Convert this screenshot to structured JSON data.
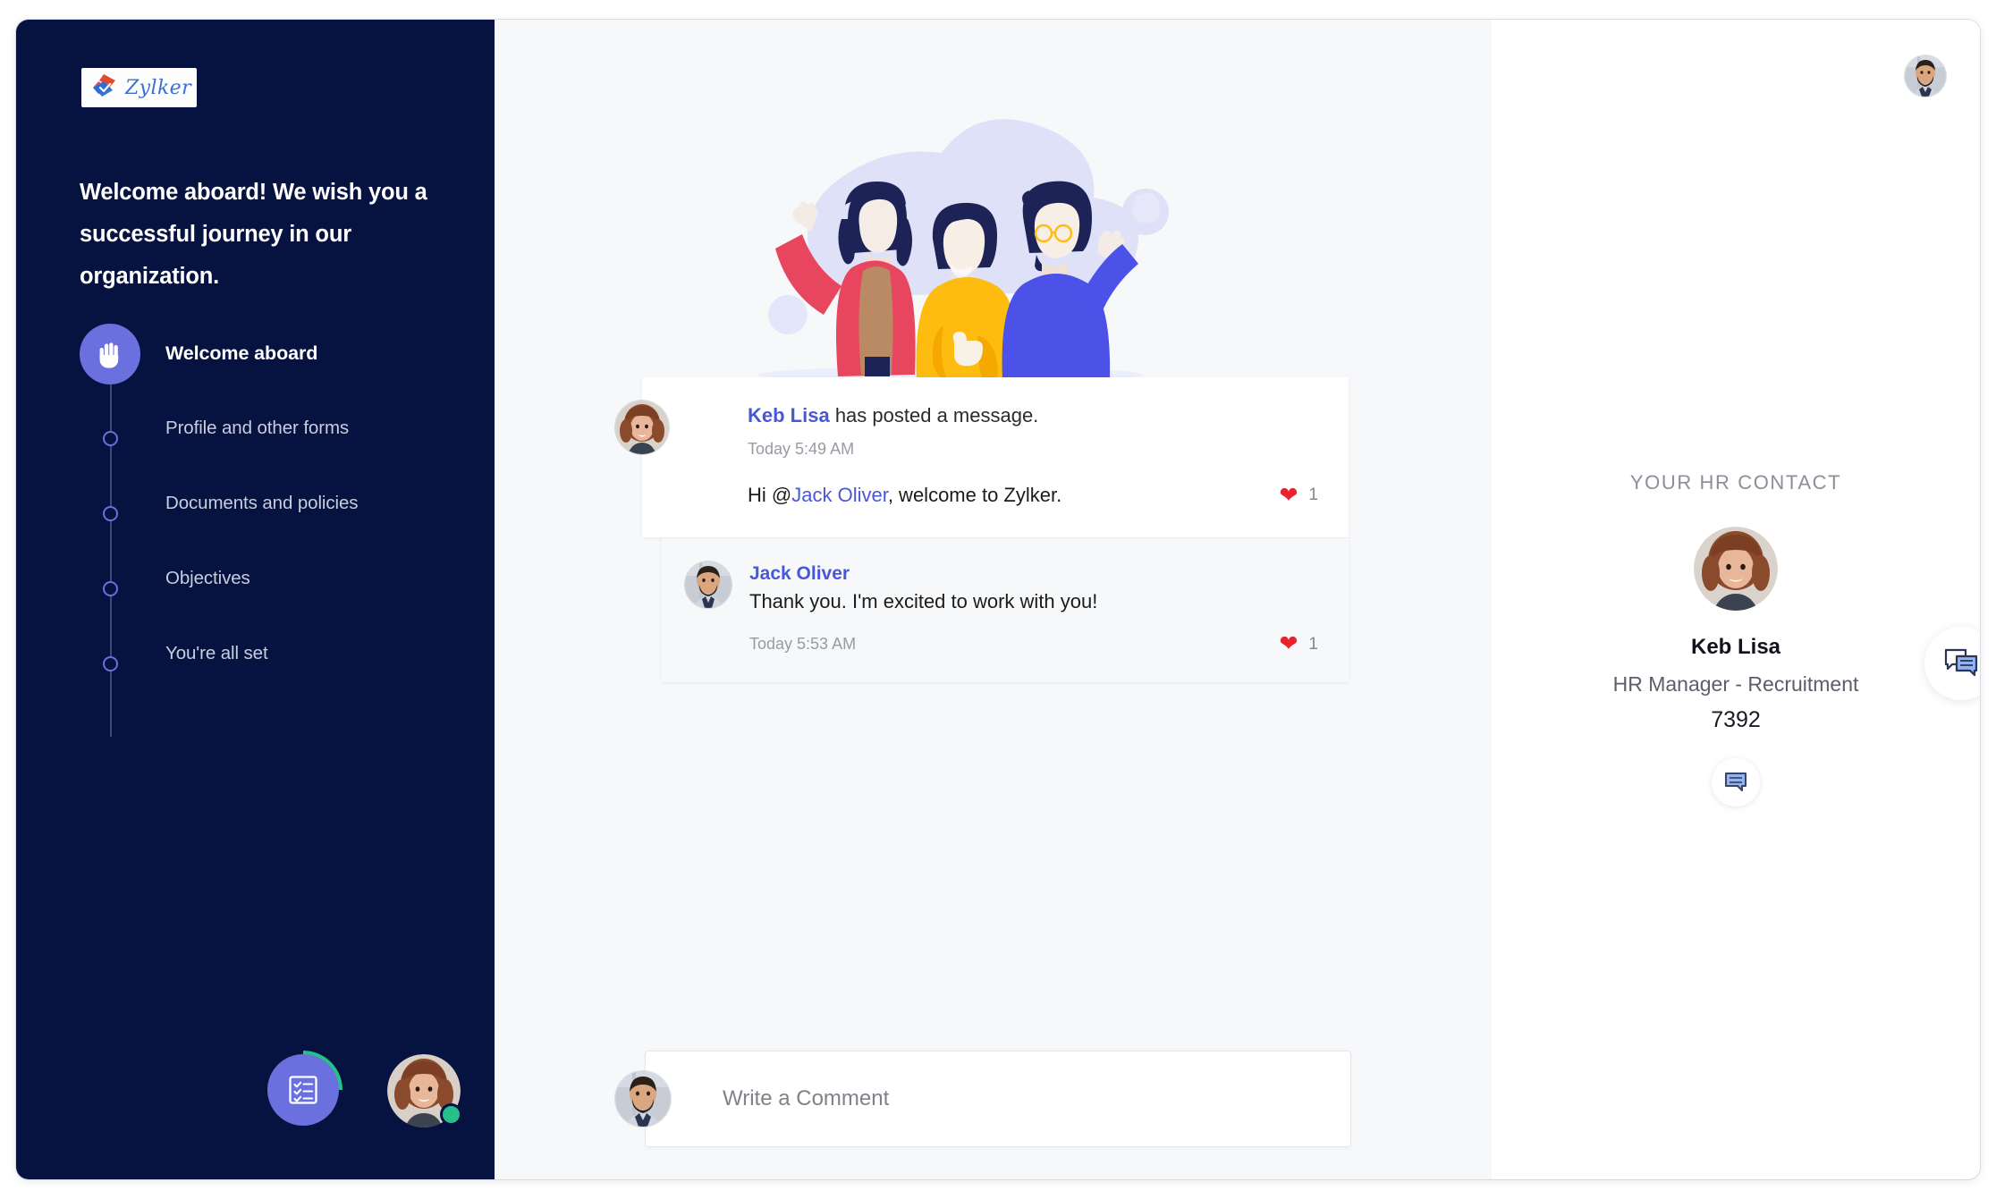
{
  "brand": {
    "logo_word": "Zylker",
    "logo_icon": "zylker-diamond-logo",
    "sidebar_bg": "#06123f",
    "accent": "#6a70dd",
    "link_color": "#4a57d8",
    "progress_color": "#27c08a",
    "heart_color": "#e8232a"
  },
  "sidebar": {
    "welcome_message": "Welcome aboard! We wish you a successful journey in our organization.",
    "steps": [
      {
        "label": "Welcome aboard",
        "state": "active",
        "icon": "waving-hand-icon"
      },
      {
        "label": "Profile and other forms",
        "state": "pending",
        "icon": "step-dot-icon"
      },
      {
        "label": "Documents and policies",
        "state": "pending",
        "icon": "step-dot-icon"
      },
      {
        "label": "Objectives",
        "state": "pending",
        "icon": "step-dot-icon"
      },
      {
        "label": "You're all set",
        "state": "pending",
        "icon": "step-dot-icon"
      }
    ],
    "footer": {
      "task_icon": "checklist-icon",
      "progress_percent": 25,
      "avatar_icon": "user-avatar-keb-lisa",
      "status": "online"
    }
  },
  "main": {
    "illustration": "three-people-welcome-illustration",
    "posts": [
      {
        "avatar": "avatar-keb-lisa",
        "author": "Keb Lisa",
        "header_suffix": " has posted a message.",
        "time": "Today 5:49 AM",
        "body_prefix": "Hi @",
        "body_mention": "Jack Oliver",
        "body_suffix": ", welcome to Zylker.",
        "reaction_icon": "heart-icon",
        "reaction_count": "1"
      },
      {
        "avatar": "avatar-jack-oliver",
        "author": "Jack Oliver",
        "body": "Thank you. I'm excited to work with you!",
        "time": "Today 5:53 AM",
        "reaction_icon": "heart-icon",
        "reaction_count": "1"
      }
    ],
    "comment": {
      "avatar": "avatar-jack-oliver",
      "placeholder": "Write a Comment"
    },
    "floating_chat_icon": "chat-bubbles-icon"
  },
  "right": {
    "topbar_avatar": "avatar-jack-oliver",
    "hr_contact": {
      "title": "YOUR HR CONTACT",
      "avatar": "avatar-keb-lisa",
      "name": "Keb Lisa",
      "role": "HR Manager - Recruitment",
      "extension": "7392",
      "chat_icon": "chat-bubble-icon"
    }
  }
}
